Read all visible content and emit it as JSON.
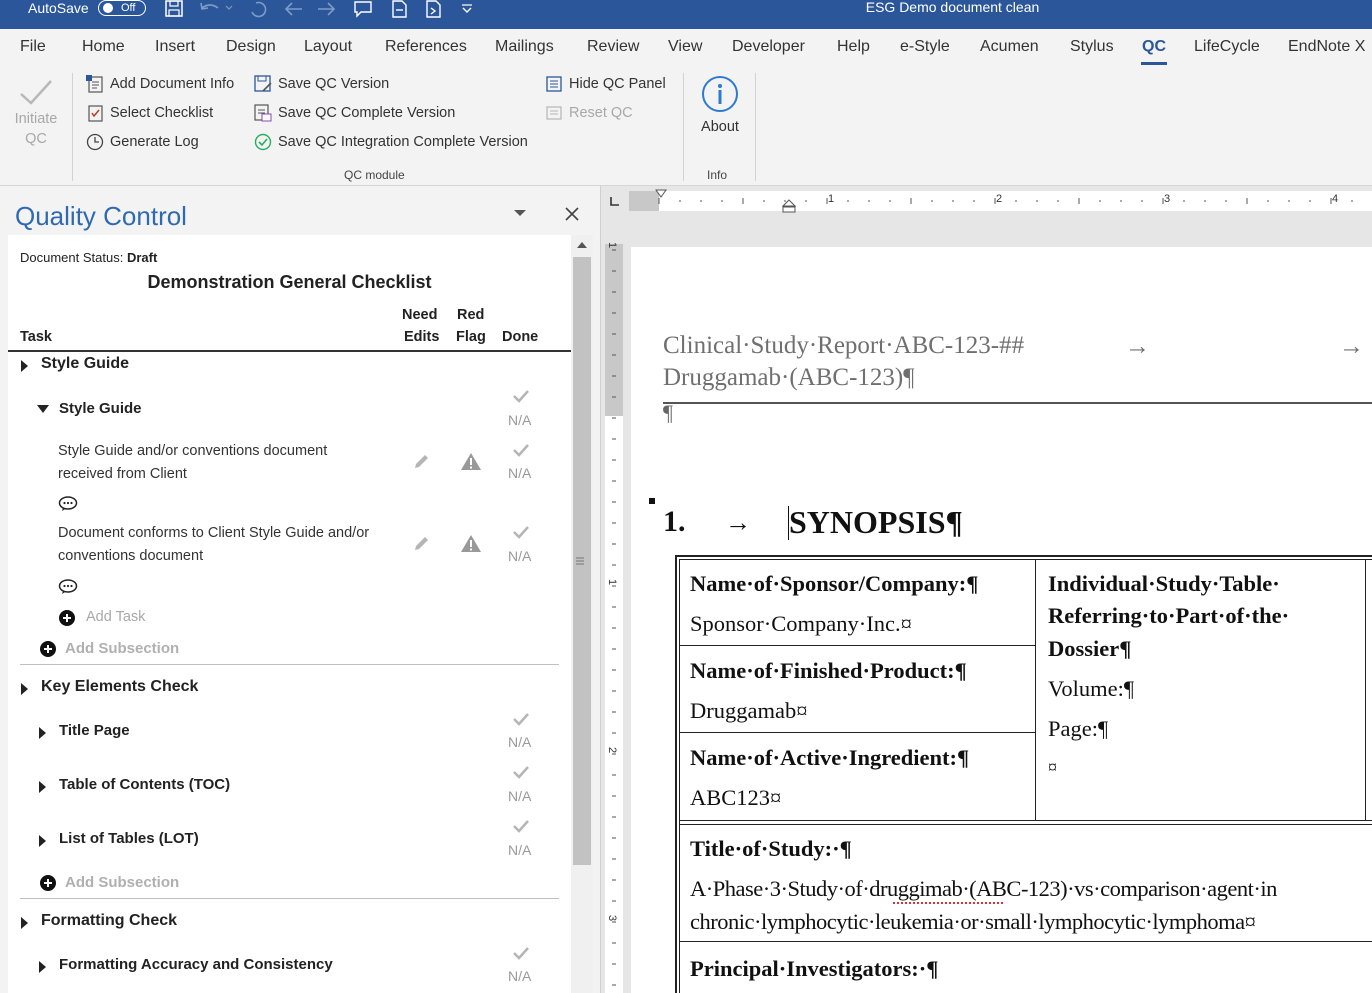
{
  "titlebar": {
    "autosave_label": "AutoSave",
    "autosave_state": "Off",
    "document_title": "ESG Demo document clean"
  },
  "tabs": [
    "File",
    "Home",
    "Insert",
    "Design",
    "Layout",
    "References",
    "Mailings",
    "Review",
    "View",
    "Developer",
    "Help",
    "e-Style",
    "Acumen",
    "Stylus",
    "QC",
    "LifeCycle",
    "EndNote X"
  ],
  "active_tab": "QC",
  "ribbon": {
    "initiate_qc": "Initiate QC",
    "add_document_info": "Add Document Info",
    "select_checklist": "Select Checklist",
    "generate_log": "Generate Log",
    "save_qc_version": "Save QC Version",
    "save_qc_complete_version": "Save QC Complete Version",
    "save_qc_integration_complete_version": "Save QC Integration Complete Version",
    "hide_qc_panel": "Hide QC Panel",
    "reset_qc": "Reset QC",
    "qc_module_group": "QC module",
    "about": "About",
    "info_group": "Info"
  },
  "qc": {
    "panel_title": "Quality Control",
    "status_label": "Document Status:",
    "status_value": "Draft",
    "checklist_title": "Demonstration General Checklist",
    "col_task": "Task",
    "col_need": "Need",
    "col_edits": "Edits",
    "col_red": "Red",
    "col_flag": "Flag",
    "col_done": "Done",
    "na": "N/A",
    "section_style_guide": "Style Guide",
    "subsection_style_guide": "Style Guide",
    "task1": "Style Guide and/or conventions document received from Client",
    "task2": "Document conforms to Client Style Guide and/or conventions document",
    "add_task": "Add Task",
    "add_subsection": "Add Subsection",
    "section_key_elements": "Key Elements Check",
    "sub_title_page": "Title Page",
    "sub_toc": "Table of Contents (TOC)",
    "sub_lot": "List of Tables (LOT)",
    "section_formatting": "Formatting Check",
    "sub_formatting_accuracy": "Formatting Accuracy and Consistency"
  },
  "ruler": {
    "h_labels": [
      "1",
      "2",
      "3",
      "4"
    ],
    "v_labels": [
      "1",
      "1",
      "2",
      "3"
    ]
  },
  "document": {
    "header_line1": "Clinical·Study·Report·ABC-123-##",
    "header_line2": "Druggamab·(ABC-123)¶",
    "arrow": "→",
    "pilcrow": "¶",
    "heading_number": "1.",
    "heading_text": "SYNOPSIS¶",
    "sponsor_label": "Name·of·Sponsor/Company:¶",
    "sponsor_value": "Sponsor·Company·Inc.¤",
    "product_label": "Name·of·Finished·Product:¶",
    "product_value": "Druggamab¤",
    "ingredient_label": "Name·of·Active·Ingredient:¶",
    "ingredient_value": "ABC123¤",
    "ist_line1": "Individual·Study·Table·",
    "ist_line2": "Referring·to·Part·of·the·",
    "ist_line3": "Dossier¶",
    "volume": "Volume:¶",
    "page": "Page:¶",
    "cell_end": "¤",
    "title_label": "Title·of·Study:·¶",
    "title_line1": "A·Phase·3·Study·of·druggimab·(ABC-123)·vs·comparison·agent·in",
    "title_line2": "chronic·lymphocytic·leukemia·or·small·lymphocytic·lymphoma¤",
    "investigators_label": "Principal·Investigators:·¶"
  }
}
